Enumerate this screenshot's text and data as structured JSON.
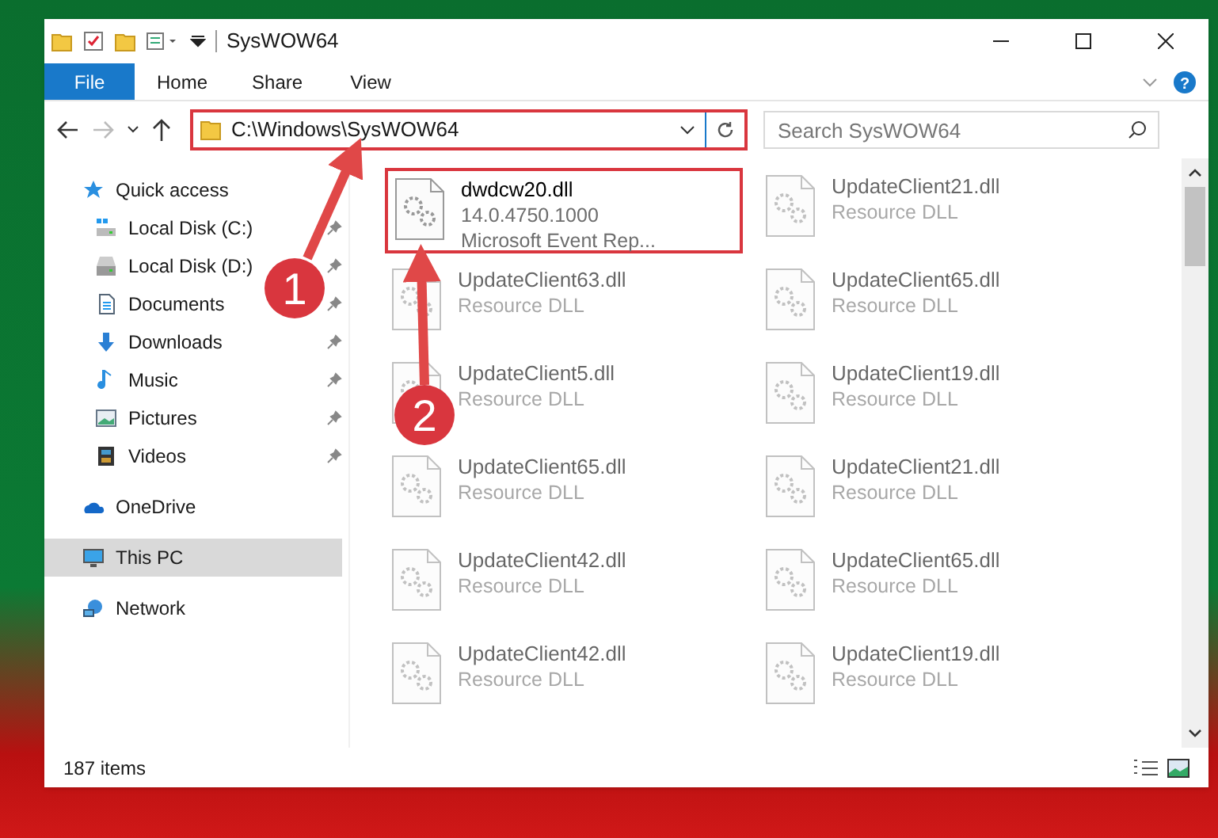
{
  "window": {
    "title": "SysWOW64"
  },
  "ribbon_tabs": [
    {
      "label": "File",
      "kind": "file",
      "selected": false
    },
    {
      "label": "Home",
      "kind": "tab",
      "selected": false
    },
    {
      "label": "Share",
      "kind": "tab",
      "selected": false
    },
    {
      "label": "View",
      "kind": "tab",
      "selected": false
    }
  ],
  "address": {
    "path": "C:\\Windows\\SysWOW64"
  },
  "search": {
    "placeholder": "Search SysWOW64"
  },
  "help": {
    "label": "?"
  },
  "sidebar": {
    "items": [
      {
        "label": "Quick access",
        "kind": "star",
        "selected": false,
        "children": [
          {
            "label": "Local Disk (C:)",
            "kind": "system-drive",
            "pinned": true,
            "selected": false
          },
          {
            "label": "Local Disk (D:)",
            "kind": "drive",
            "pinned": true,
            "selected": false
          },
          {
            "label": "Documents",
            "kind": "documents",
            "pinned": true,
            "selected": false
          },
          {
            "label": "Downloads",
            "kind": "downloads",
            "pinned": true,
            "selected": false
          },
          {
            "label": "Music",
            "kind": "music",
            "pinned": true,
            "selected": false
          },
          {
            "label": "Pictures",
            "kind": "pictures",
            "pinned": true,
            "selected": false
          },
          {
            "label": "Videos",
            "kind": "videos",
            "pinned": true,
            "selected": false
          }
        ]
      },
      {
        "label": "OneDrive",
        "kind": "cloud",
        "selected": false
      },
      {
        "label": "This PC",
        "kind": "pc",
        "selected": true
      },
      {
        "label": "Network",
        "kind": "network",
        "selected": false
      }
    ]
  },
  "files": [
    {
      "name": "dwdcw20.dll",
      "lines": [
        "14.0.4750.1000",
        "Microsoft Event Rep..."
      ],
      "faded": false
    },
    {
      "name": "UpdateClient21.dll",
      "lines": [
        "Resource DLL"
      ],
      "faded": true
    },
    {
      "name": "UpdateClient63.dll",
      "lines": [
        "Resource DLL"
      ],
      "faded": true
    },
    {
      "name": "UpdateClient65.dll",
      "lines": [
        "Resource DLL"
      ],
      "faded": true
    },
    {
      "name": "UpdateClient5.dll",
      "lines": [
        "Resource DLL"
      ],
      "faded": true
    },
    {
      "name": "UpdateClient19.dll",
      "lines": [
        "Resource DLL"
      ],
      "faded": true
    },
    {
      "name": "UpdateClient65.dll",
      "lines": [
        "Resource DLL"
      ],
      "faded": true
    },
    {
      "name": "UpdateClient21.dll",
      "lines": [
        "Resource DLL"
      ],
      "faded": true
    },
    {
      "name": "UpdateClient42.dll",
      "lines": [
        "Resource DLL"
      ],
      "faded": true
    },
    {
      "name": "UpdateClient65.dll",
      "lines": [
        "Resource DLL"
      ],
      "faded": true
    },
    {
      "name": "UpdateClient42.dll",
      "lines": [
        "Resource DLL"
      ],
      "faded": true
    },
    {
      "name": "UpdateClient19.dll",
      "lines": [
        "Resource DLL"
      ],
      "faded": true
    }
  ],
  "status_bar": {
    "text": "187 items"
  },
  "annotations": [
    {
      "label": "1"
    },
    {
      "label": "2"
    }
  ]
}
